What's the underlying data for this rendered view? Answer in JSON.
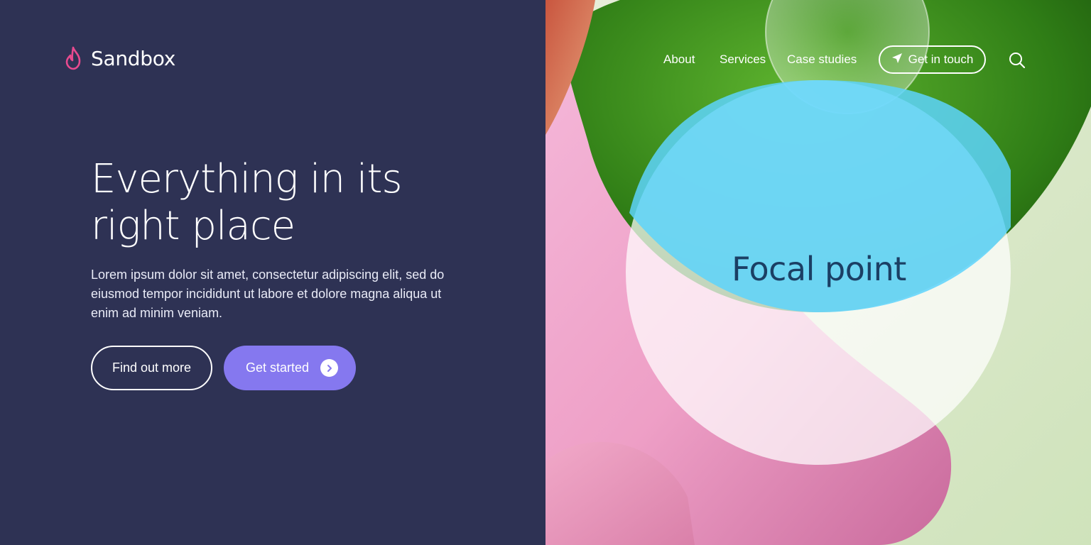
{
  "brand": {
    "name": "Sandbox",
    "icon": "flame-icon",
    "icon_color": "#e84a8f"
  },
  "nav": {
    "items": [
      {
        "label": "About"
      },
      {
        "label": "Services"
      },
      {
        "label": "Case studies"
      }
    ],
    "cta_label": "Get in touch",
    "cta_icon": "paper-plane-icon",
    "search_icon": "search-icon"
  },
  "hero": {
    "title_line1": "Everything in its",
    "title_line2": "right place",
    "body": "Lorem ipsum dolor sit amet, consectetur adipiscing elit, sed do eiusmod tempor incididunt ut labore et dolore magna aliqua ut enim ad minim veniam.",
    "secondary_button": "Find out more",
    "primary_button": "Get started",
    "primary_button_icon": "chevron-right-icon"
  },
  "showcase": {
    "label": "Focal point"
  },
  "colors": {
    "panel_bg": "#2e3254",
    "primary": "#8578ef",
    "focal_text": "#1b3f64"
  }
}
